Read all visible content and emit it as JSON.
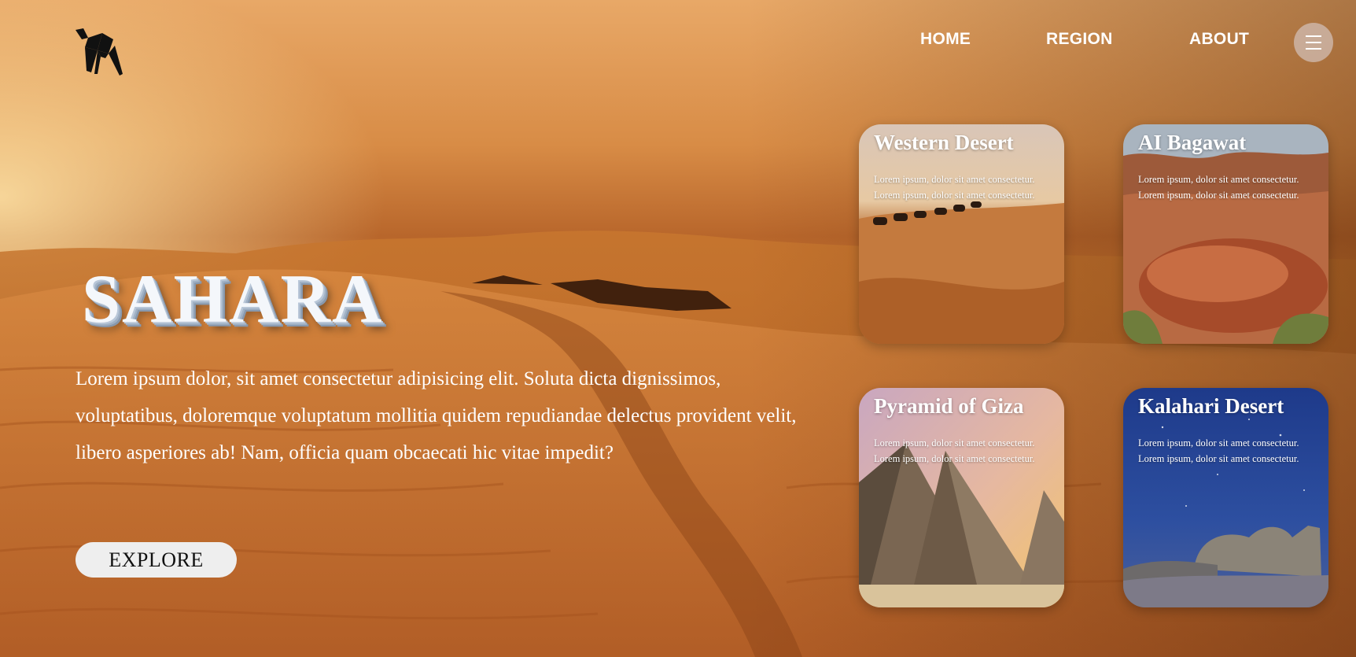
{
  "brand": {
    "logo_icon": "camel-logo-icon"
  },
  "nav": {
    "links": [
      "HOME",
      "REGION",
      "ABOUT"
    ],
    "menu_icon": "hamburger-menu-icon"
  },
  "hero": {
    "title": "SAHARA",
    "description": "Lorem ipsum dolor, sit amet consectetur adipisicing elit. Soluta dicta dignissimos, voluptatibus, doloremque voluptatum mollitia quidem repudiandae delectus provident velit, libero asperiores ab! Nam, officia quam obcaecati hic vitae impedit?",
    "cta_label": "EXPLORE"
  },
  "cards": [
    {
      "title": "Western Desert",
      "lines": [
        "Lorem ipsum, dolor sit amet consectetur.",
        "Lorem ipsum, dolor sit amet consectetur."
      ]
    },
    {
      "title": "AI Bagawat",
      "lines": [
        "Lorem ipsum, dolor sit amet consectetur.",
        "Lorem ipsum, dolor sit amet consectetur."
      ]
    },
    {
      "title": "Pyramid of Giza",
      "lines": [
        "Lorem ipsum, dolor sit amet consectetur.",
        "Lorem ipsum, dolor sit amet consectetur."
      ]
    },
    {
      "title": "Kalahari Desert",
      "lines": [
        "Lorem ipsum, dolor sit amet consectetur.",
        "Lorem ipsum, dolor sit amet consectetur."
      ]
    }
  ],
  "colors": {
    "sand": "#cf7a34",
    "sky_glow": "#ffe6aa",
    "button_bg": "#eeeeee",
    "menu_bg": "#d2beb4"
  }
}
